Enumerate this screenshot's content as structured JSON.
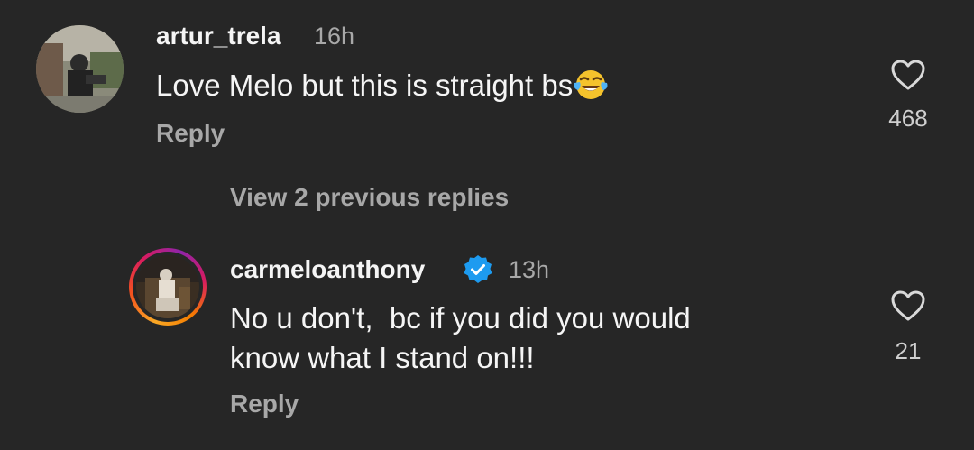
{
  "comments": [
    {
      "username": "artur_trela",
      "time": "16h",
      "text": "Love Melo but this is straight bs",
      "emoji": "face-with-tears-of-joy",
      "reply_label": "Reply",
      "like_count": "468",
      "icons": {
        "like": "heart-outline-icon"
      }
    },
    {
      "username": "carmeloanthony",
      "time": "13h",
      "verified": true,
      "text_line1": "No u don't,  bc if you did you would",
      "text_line2": "know what I stand on!!!",
      "reply_label": "Reply",
      "like_count": "21",
      "icons": {
        "like": "heart-outline-icon",
        "verified": "verified-badge-icon"
      }
    }
  ],
  "view_replies_label": "View 2 previous replies",
  "colors": {
    "background": "#262626",
    "primary_text": "#f5f5f5",
    "secondary_text": "#a8a8a8",
    "verified": "#1d9bf0"
  }
}
